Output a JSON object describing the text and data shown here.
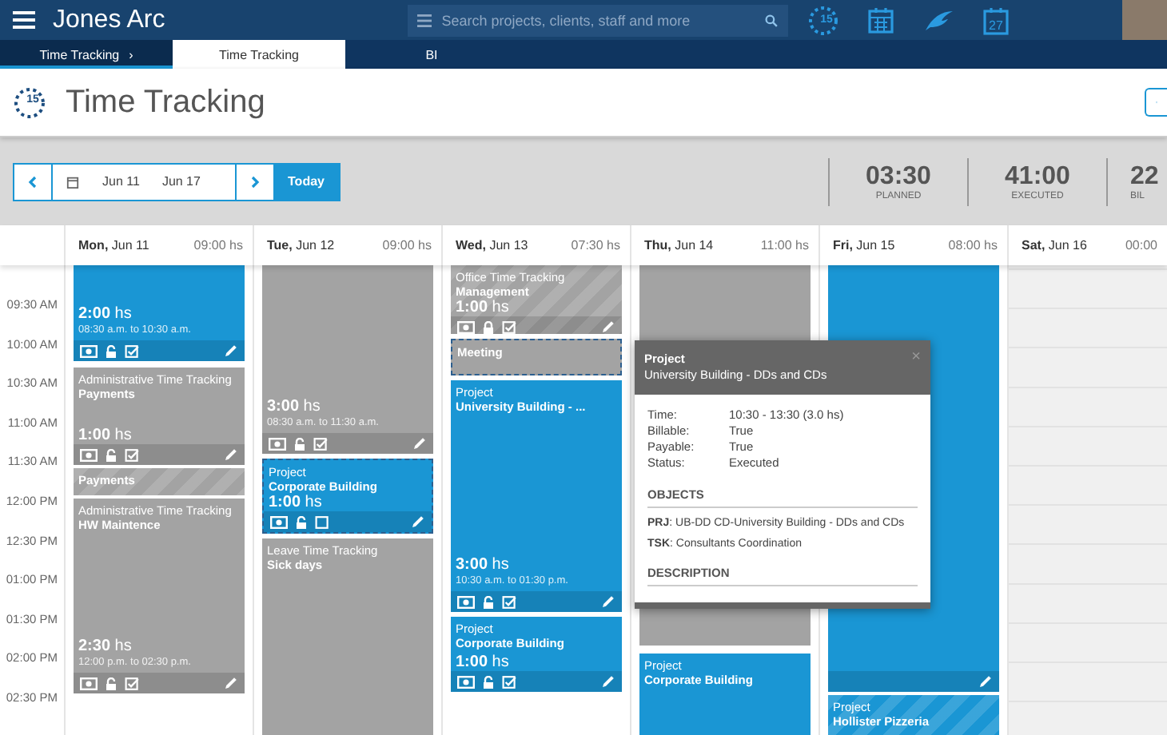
{
  "topbar": {
    "brand": "Jones Arc",
    "search": {
      "placeholder": "Search projects, clients, staff and more"
    },
    "icons": [
      {
        "kind": "clock",
        "badge": "15"
      },
      {
        "kind": "calendar"
      },
      {
        "kind": "wing"
      },
      {
        "kind": "calendar-day",
        "badge": "27"
      }
    ]
  },
  "tabs": [
    {
      "label": "Time Tracking",
      "kind": "crumb",
      "separator": "›",
      "selected": false
    },
    {
      "label": "Time Tracking",
      "kind": "tab",
      "selected": true
    },
    {
      "label": "BI",
      "kind": "tab",
      "selected": false
    }
  ],
  "page": {
    "title": "Time Tracking",
    "icon_badge": "15"
  },
  "toolbar": {
    "range_start": "Jun 11",
    "range_end": "Jun 17",
    "today": "Today",
    "stats": [
      {
        "value": "03:30",
        "label": "PLANNED"
      },
      {
        "value": "41:00",
        "label": "EXECUTED"
      },
      {
        "value": "22",
        "label": "BIL"
      }
    ]
  },
  "times": [
    "09:30 AM",
    "10:00 AM",
    "10:30 AM",
    "11:00 AM",
    "11:30 AM",
    "12:00 PM",
    "12:30 PM",
    "01:00 PM",
    "01:30 PM",
    "02:00 PM",
    "02:30 PM"
  ],
  "days": [
    {
      "label": "**Mon,** Jun 11",
      "hours": "09:00 hs",
      "weekend": false,
      "entries": [
        {
          "kind": "project",
          "duration": "**2:00** hs",
          "time": "08:30 a.m. to 10:30 a.m.",
          "editable": true,
          "icons": [
            {
              "kind": "money"
            },
            {
              "kind": "lock",
              "locked": false
            },
            {
              "kind": "check",
              "checked": true
            }
          ]
        },
        {
          "kind": "admin",
          "category": "Administrative Time Tracking",
          "name": "Payments",
          "duration": "**1:00** hs",
          "editable": true,
          "icons": [
            {
              "kind": "money"
            },
            {
              "kind": "lock",
              "locked": false
            },
            {
              "kind": "check",
              "checked": true
            }
          ]
        },
        {
          "kind": "admin",
          "category": "Payments",
          "striped": true,
          "bold_category": true
        },
        {
          "kind": "admin",
          "category": "Administrative Time Tracking",
          "name": "HW Maintence",
          "duration": "**2:30** hs",
          "time": "12:00 p.m. to 02:30 p.m.",
          "editable": true,
          "icons": [
            {
              "kind": "money"
            },
            {
              "kind": "lock",
              "locked": false
            },
            {
              "kind": "check",
              "checked": true
            }
          ]
        }
      ]
    },
    {
      "label": "**Tue,** Jun 12",
      "hours": "09:00 hs",
      "weekend": false,
      "entries": [
        {
          "kind": "admin",
          "duration": "**3:00** hs",
          "time": "08:30 a.m. to 11:30 a.m.",
          "editable": true,
          "icons": [
            {
              "kind": "money"
            },
            {
              "kind": "lock",
              "locked": false
            },
            {
              "kind": "check",
              "checked": true
            }
          ]
        },
        {
          "kind": "project",
          "category": "Project",
          "name": "Corporate Building",
          "duration": "**1:00** hs",
          "outlined": true,
          "editable": true,
          "icons": [
            {
              "kind": "money"
            },
            {
              "kind": "lock",
              "locked": false
            },
            {
              "kind": "check",
              "checked": false
            }
          ]
        },
        {
          "kind": "admin",
          "category": "Leave Time Tracking",
          "name": "Sick days"
        }
      ]
    },
    {
      "label": "**Wed,** Jun 13",
      "hours": "07:30 hs",
      "weekend": false,
      "entries": [
        {
          "kind": "admin",
          "category": "Office Time Tracking",
          "name": "Management",
          "duration": "**1:00** hs",
          "striped": true,
          "editable": true,
          "icons": [
            {
              "kind": "money"
            },
            {
              "kind": "lock",
              "locked": true
            },
            {
              "kind": "check",
              "checked": true
            }
          ]
        },
        {
          "kind": "admin",
          "category": "Meeting",
          "outlined": true,
          "bold_category": true
        },
        {
          "kind": "project",
          "category": "Project",
          "name": "University Building - ...",
          "duration": "**3:00** hs",
          "time": "10:30 a.m. to 01:30 p.m.",
          "editable": true,
          "icons": [
            {
              "kind": "money"
            },
            {
              "kind": "lock",
              "locked": false
            },
            {
              "kind": "check",
              "checked": true
            }
          ]
        },
        {
          "kind": "project",
          "category": "Project",
          "name": "Corporate Building",
          "duration": "**1:00** hs",
          "editable": true,
          "icons": [
            {
              "kind": "money"
            },
            {
              "kind": "lock",
              "locked": false
            },
            {
              "kind": "check",
              "checked": true
            }
          ]
        }
      ]
    },
    {
      "label": "**Thu,** Jun 14",
      "hours": "11:00 hs",
      "weekend": false,
      "entries": [
        {
          "kind": "admin"
        },
        {
          "kind": "project",
          "category": "Project",
          "name": "Corporate Building"
        }
      ]
    },
    {
      "label": "**Fri,** Jun 15",
      "hours": "08:00 hs",
      "weekend": false,
      "entries": [
        {
          "kind": "project",
          "editable": true
        },
        {
          "kind": "project",
          "category": "Project",
          "name": "Hollister Pizzeria",
          "striped": true
        }
      ]
    },
    {
      "label": "**Sat,** Jun 16",
      "hours": "00:00",
      "weekend": true
    }
  ],
  "popup": {
    "category": "Project",
    "title": "University Building - DDs and CDs",
    "close": "×",
    "rows": [
      {
        "label": "Time:",
        "value": "10:30 - 13:30 (3.0 hs)"
      },
      {
        "label": "Billable:",
        "value": "True"
      },
      {
        "label": "Payable:",
        "value": "True"
      },
      {
        "label": "Status:",
        "value": "Executed"
      }
    ],
    "objects_heading": "OBJECTS",
    "objects": [
      "**PRJ**: UB-DD CD-University Building - DDs and CDs",
      "**TSK**: Consultants Coordination"
    ],
    "description_heading": "DESCRIPTION"
  }
}
